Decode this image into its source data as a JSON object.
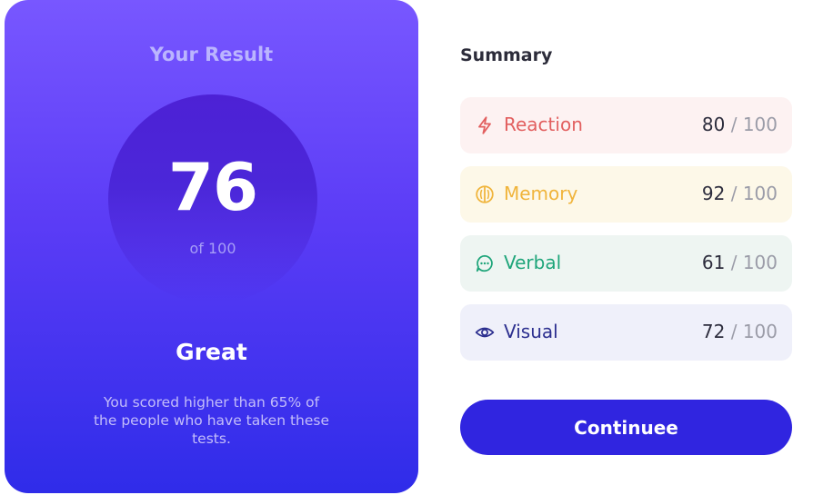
{
  "result": {
    "title": "Your Result",
    "score": "76",
    "score_of": "of 100",
    "rating": "Great",
    "description": "You scored higher than 65% of the people who have taken these tests."
  },
  "summary": {
    "title": "Summary",
    "items": [
      {
        "label": "Reaction",
        "score": "80",
        "max": " / 100",
        "icon": "lightning-icon",
        "color": "#e25f5f"
      },
      {
        "label": "Memory",
        "score": "92",
        "max": " / 100",
        "icon": "brain-icon",
        "color": "#f0b43b"
      },
      {
        "label": "Verbal",
        "score": "61",
        "max": " / 100",
        "icon": "chat-bubble-icon",
        "color": "#1ea57a"
      },
      {
        "label": "Visual",
        "score": "72",
        "max": " / 100",
        "icon": "eye-icon",
        "color": "#2c2f8f"
      }
    ]
  },
  "continue_label": "Continuee",
  "colors": {
    "accent": "#3025e0",
    "panel_gradient_top": "#7857ff",
    "panel_gradient_bottom": "#2f2ce9"
  }
}
